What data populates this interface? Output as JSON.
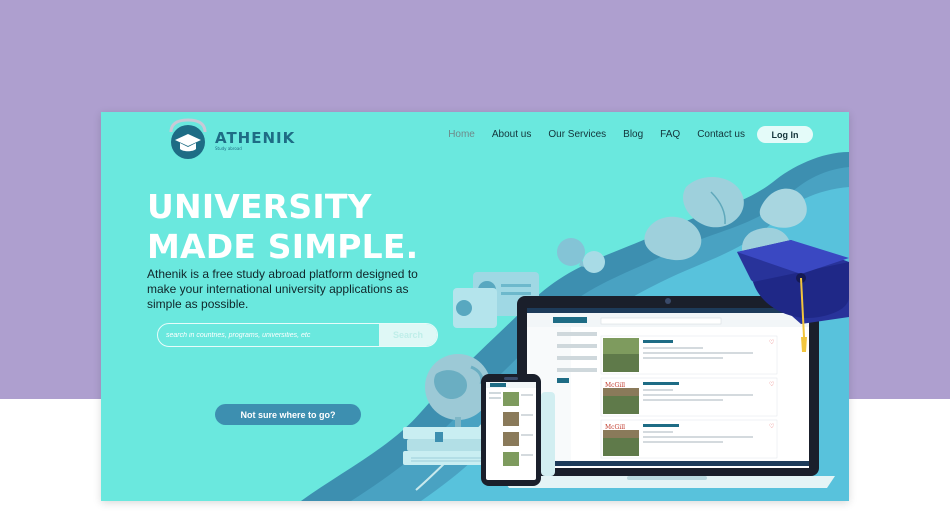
{
  "nav": {
    "brand": "ATHENIK",
    "tagline": "Study abroad",
    "items": [
      "Home",
      "About us",
      "Our Services",
      "Blog",
      "FAQ",
      "Contact us"
    ],
    "active": "Home",
    "login_label": "Log In"
  },
  "hero": {
    "title_line1": "UNIVERSITY",
    "title_line2": "MADE SIMPLE.",
    "subtitle": "Athenik is a free study abroad platform designed to make your international university applications as simple as possible."
  },
  "search": {
    "placeholder": "search in countries, programs, universities, etc",
    "button_label": "Search"
  },
  "cta": {
    "label": "Not sure where to go?"
  },
  "colors": {
    "page_bg": "#ae9fcf",
    "site_bg": "#6ae8de",
    "accent_dark": "#1e6c85",
    "cta_bg": "#3d8fb0",
    "wave": "#3d8fb0"
  }
}
